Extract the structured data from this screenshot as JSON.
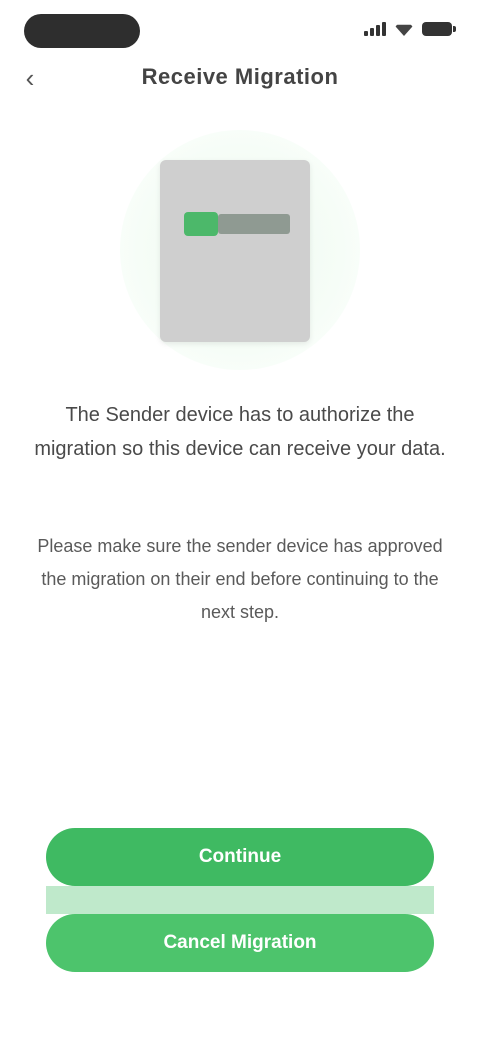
{
  "status_bar": {
    "pill_color": "#2e2e2e",
    "icons": [
      "signal-icon",
      "wifi-icon",
      "battery-icon"
    ]
  },
  "header": {
    "back_icon": "chevron-left-icon",
    "back_glyph": "‹",
    "title": "Receive Migration"
  },
  "illustration": {
    "icon": "document-check-icon",
    "accent": "#4cb86a"
  },
  "content": {
    "headline": "The Sender device has to authorize the migration so this device can receive your data.",
    "body": "Please make sure the sender device has approved the migration on their end before continuing to the next step."
  },
  "actions": {
    "primary_label": "Continue",
    "secondary_label": "Cancel Migration",
    "primary_color": "#3fba62",
    "secondary_color": "#4dc46c"
  }
}
